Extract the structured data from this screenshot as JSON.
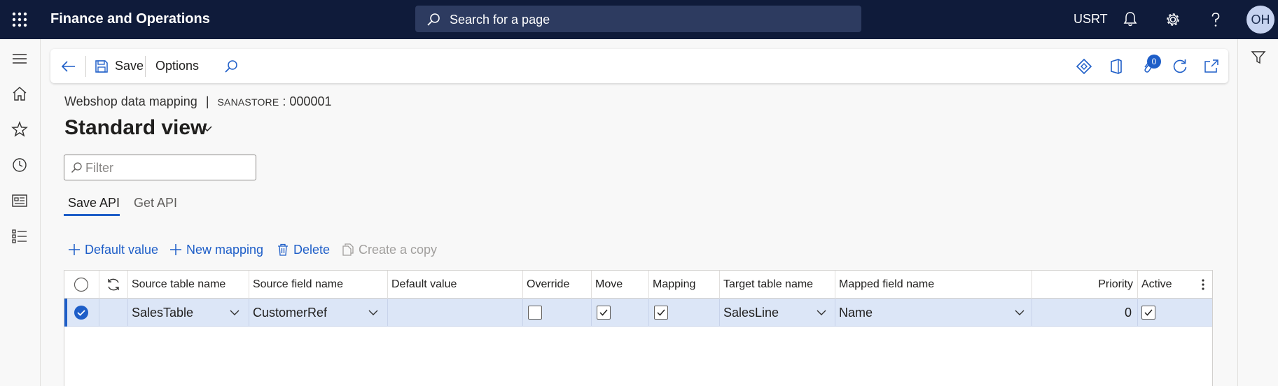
{
  "app": {
    "title": "Finance and Operations",
    "company": "USRT",
    "user_initials": "OH"
  },
  "search": {
    "placeholder": "Search for a page"
  },
  "action_pane": {
    "save_label": "Save",
    "options_label": "Options",
    "attachments_count": "0"
  },
  "breadcrumb": {
    "form": "Webshop data mapping",
    "separator": "|",
    "record_prefix": "SANASTORE",
    "record_suffix": " : 000001"
  },
  "view": {
    "title": "Standard view"
  },
  "filter": {
    "placeholder": "Filter"
  },
  "tabs": [
    {
      "label": "Save API",
      "active": true
    },
    {
      "label": "Get API",
      "active": false
    }
  ],
  "toolbar": {
    "default_value": "Default value",
    "new_mapping": "New mapping",
    "delete": "Delete",
    "create_copy": "Create a copy"
  },
  "grid": {
    "columns": [
      "Source table name",
      "Source field name",
      "Default value",
      "Override",
      "Move",
      "Mapping",
      "Target table name",
      "Mapped field name",
      "Priority",
      "Active"
    ],
    "rows": [
      {
        "selected": true,
        "source_table": "SalesTable",
        "source_field": "CustomerRef",
        "default_value": "",
        "override": false,
        "move": true,
        "mapping": true,
        "target_table": "SalesLine",
        "mapped_field": "Name",
        "priority": "0",
        "active": true
      }
    ]
  },
  "colors": {
    "topbar": "#0f1b3a",
    "accent": "#1e5ec8",
    "row_selected": "#dce6f7"
  }
}
